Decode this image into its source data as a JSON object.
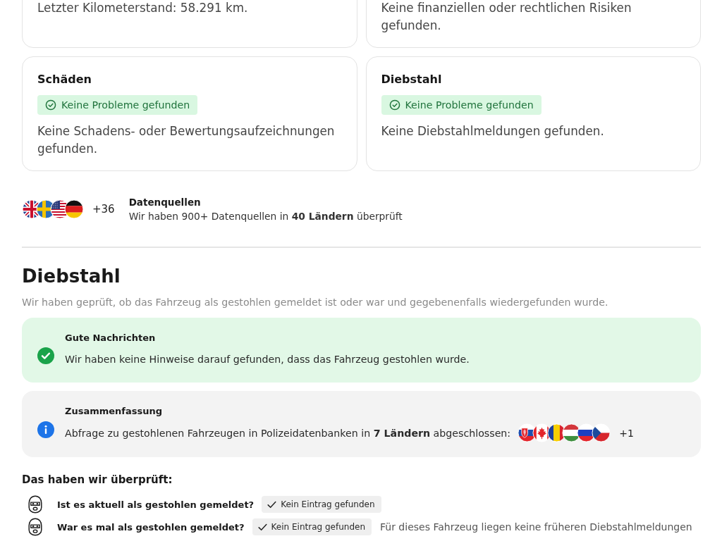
{
  "report_cards": [
    {
      "text": "Letzter Kilometerstand: 58.291 km."
    },
    {
      "text": "Keine finanziellen oder rechtlichen Risiken gefunden."
    },
    {
      "title": "Schäden",
      "badge": "Keine Probleme gefunden",
      "text": "Keine Schadens- oder Bewertungsaufzeichnungen gefunden."
    },
    {
      "title": "Diebstahl",
      "badge": "Keine Probleme gefunden",
      "text": "Keine Diebstahlmeldungen gefunden."
    }
  ],
  "data_sources": {
    "more_count": "+36",
    "title": "Datenquellen",
    "text": "Wir haben 900+ Datenquellen in **40 Ländern** überprüft"
  },
  "theft_section": {
    "heading": "Diebstahl",
    "intro": "Wir haben geprüft, ob das Fahrzeug als gestohlen gemeldet ist oder war und gegebenenfalls wiedergefunden wurde.",
    "alerts": [
      {
        "kind": "success",
        "title": "Gute Nachrichten",
        "text": "Wir haben keine Hinweise darauf gefunden, dass das Fahrzeug gestohlen wurde."
      },
      {
        "kind": "info",
        "title": "Zusammenfassung",
        "text": "Abfrage zu gestohlenen Fahrzeugen in Polizeidatenbanken in **7 Ländern** abgeschlossen:",
        "more_count": "+1"
      }
    ],
    "checks_heading": "Das haben wir überprüft:",
    "checks": [
      {
        "question": "Ist es aktuell als gestohlen gemeldet?",
        "result": "Kein Eintrag gefunden"
      },
      {
        "question": "War es mal als gestohlen gemeldet?",
        "result": "Kein Eintrag gefunden",
        "note": "Für dieses Fahrzeug liegen keine früheren Diebstahlmeldungen"
      }
    ]
  }
}
